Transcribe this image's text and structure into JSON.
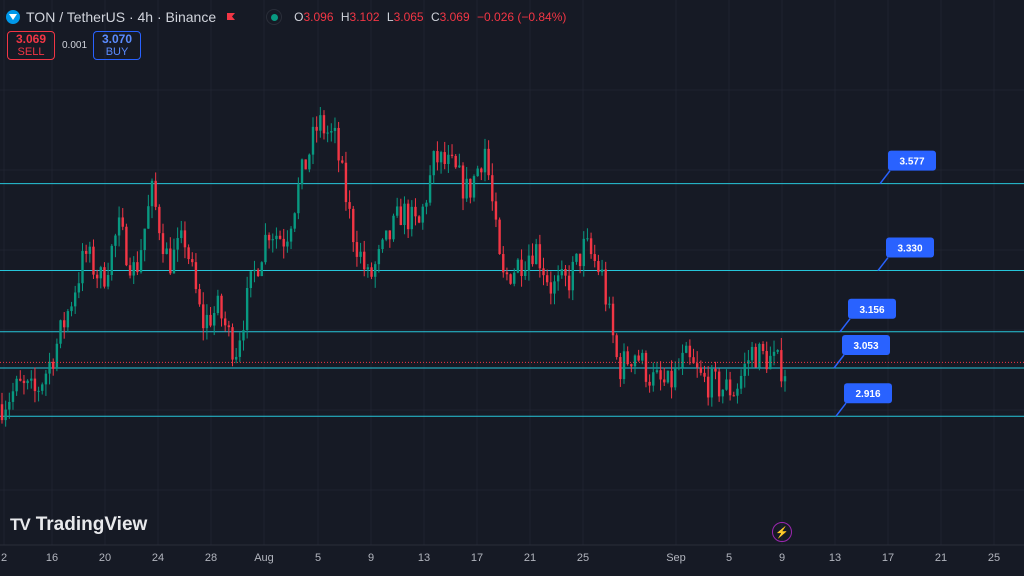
{
  "header": {
    "title": "TON / TetherUS · 4h · Binance",
    "ohlc": [
      {
        "key": "O",
        "value": "3.096"
      },
      {
        "key": "H",
        "value": "3.102"
      },
      {
        "key": "L",
        "value": "3.065"
      },
      {
        "key": "C",
        "value": "3.069"
      },
      {
        "key": "",
        "value": "−0.026 (−0.84%)"
      }
    ]
  },
  "trade": {
    "sell_price": "3.069",
    "sell_label": "SELL",
    "spread": "0.001",
    "buy_price": "3.070",
    "buy_label": "BUY"
  },
  "logo": {
    "text": "TradingView"
  },
  "colors": {
    "background": "#161a25",
    "up": "#089981",
    "down": "#f23645",
    "line": "#26c6da",
    "label": "#2962ff",
    "grid": "#1f2330"
  },
  "icons": {
    "symbol": "toncoin-icon",
    "flag": "flag-icon",
    "bolt": "lightning-icon"
  },
  "chart_data": {
    "type": "candlestick",
    "x_axis_ticks": [
      "2",
      "16",
      "20",
      "24",
      "28",
      "Aug",
      "5",
      "9",
      "13",
      "17",
      "21",
      "25",
      "Sep",
      "5",
      "9",
      "13",
      "17",
      "21",
      "25"
    ],
    "y_range": [
      2.55,
      3.9
    ],
    "horizontal_levels": [
      3.577,
      3.33,
      3.156,
      3.053,
      2.916
    ],
    "level_labels": [
      "3.577",
      "3.330",
      "3.156",
      "3.053",
      "2.916"
    ],
    "last_price": 3.069,
    "path": [
      2.95,
      3.0,
      2.98,
      3.08,
      3.22,
      3.38,
      3.3,
      3.45,
      3.32,
      3.55,
      3.35,
      3.42,
      3.18,
      3.22,
      3.1,
      3.3,
      3.45,
      3.42,
      3.6,
      3.75,
      3.7,
      3.45,
      3.3,
      3.4,
      3.5,
      3.45,
      3.65,
      3.62,
      3.55,
      3.68,
      3.3,
      3.35,
      3.4,
      3.28,
      3.3,
      3.4,
      3.32,
      3.05,
      3.1,
      3.02,
      3.0,
      3.08,
      3.02,
      3.0,
      2.99,
      3.1,
      3.08,
      3.05
    ]
  }
}
